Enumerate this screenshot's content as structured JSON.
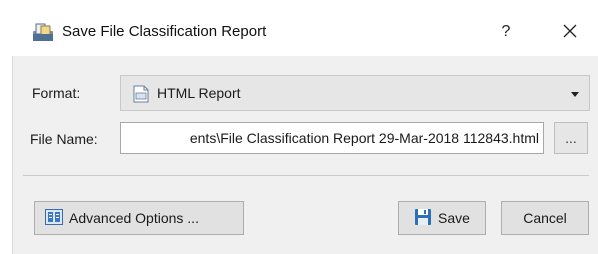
{
  "window": {
    "title": "Save File Classification Report",
    "help_label": "?",
    "close_label": "✕"
  },
  "form": {
    "format_label": "Format:",
    "format_value": "HTML Report",
    "filename_label": "File Name:",
    "filename_value": "ents\\File Classification Report 29-Mar-2018 112843.html",
    "browse_label": "..."
  },
  "buttons": {
    "advanced_label": "Advanced Options ...",
    "save_label": "Save",
    "cancel_label": "Cancel"
  },
  "icons": {
    "title": "report-app-icon",
    "format": "html-document-icon",
    "advanced": "options-icon",
    "save": "floppy-disk-icon"
  },
  "colors": {
    "accent_blue": "#2f6fb6",
    "dialog_bg": "#f0f0f0"
  }
}
